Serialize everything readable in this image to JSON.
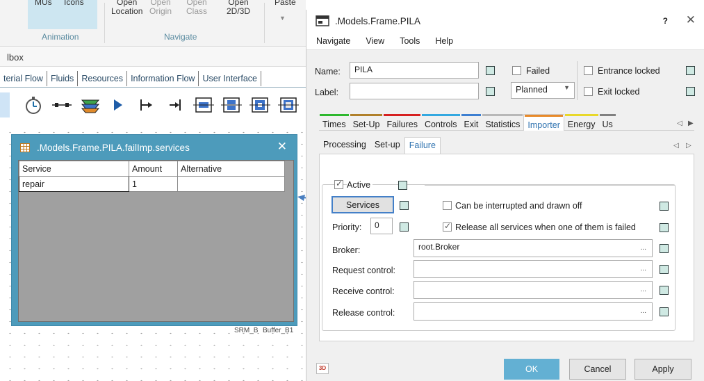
{
  "ribbon": {
    "mus": "MUs",
    "icons": "Icons",
    "animation_group": "Animation",
    "open_location": [
      "Open",
      "Location"
    ],
    "open_origin": [
      "Open",
      "Origin"
    ],
    "open_class": [
      "Open",
      "Class"
    ],
    "open_2d3d": [
      "Open",
      "2D/3D"
    ],
    "navigate_group": "Navigate",
    "paste": "Paste"
  },
  "toolbox": {
    "title": "lbox",
    "tabs": [
      "terial Flow",
      "Fluids",
      "Resources",
      "Information Flow",
      "User Interface"
    ],
    "icons": [
      "stopwatch-icon",
      "source-icon",
      "layers-icon",
      "play-icon",
      "entrance-icon",
      "drain-icon",
      "single-proc-icon",
      "parallel-proc-icon",
      "assembly-icon",
      "dismantle-icon"
    ]
  },
  "canvas": {
    "labels": [
      "SRM_B",
      "Buffer_B1"
    ]
  },
  "services_window": {
    "title": ".Models.Frame.PILA.failImp.services",
    "columns": [
      "Service",
      "Amount",
      "Alternative"
    ],
    "rows": [
      [
        "repair",
        "1",
        ""
      ]
    ]
  },
  "dialog": {
    "title": ".Models.Frame.PILA",
    "help_glyph": "?",
    "menu": [
      "Navigate",
      "View",
      "Tools",
      "Help"
    ],
    "name_label": "Name:",
    "name_value": "PILA",
    "label_label": "Label:",
    "label_value": "",
    "failed_label": "Failed",
    "planned_value": "Planned",
    "entrance_locked_label": "Entrance locked",
    "exit_locked_label": "Exit locked",
    "tabs": [
      {
        "label": "Times",
        "color": "#2eb82e"
      },
      {
        "label": "Set-Up",
        "color": "#b0802a"
      },
      {
        "label": "Failures",
        "color": "#d62020"
      },
      {
        "label": "Controls",
        "color": "#33a8e0"
      },
      {
        "label": "Exit",
        "color": "#3d7fd1"
      },
      {
        "label": "Statistics",
        "color": "#b8b8b8"
      },
      {
        "label": "Importer",
        "color": "#e88a2a"
      },
      {
        "label": "Energy",
        "color": "#e8d82a"
      },
      {
        "label": "Us",
        "color": "#808080"
      }
    ],
    "active_tab": "Importer",
    "subtabs": [
      "Processing",
      "Set-up",
      "Failure"
    ],
    "active_subtab": "Failure",
    "active_label": "Active",
    "services_button": "Services",
    "interrupt_label": "Can be interrupted and drawn off",
    "priority_label": "Priority:",
    "priority_value": "0",
    "release_all_label": "Release all services when one of them is failed",
    "broker_label": "Broker:",
    "broker_value": "root.Broker",
    "request_control_label": "Request control:",
    "receive_control_label": "Receive control:",
    "release_control_label": "Release control:",
    "ellipsis": "...",
    "button_3d": "3D",
    "ok": "OK",
    "cancel": "Cancel",
    "apply": "Apply"
  }
}
